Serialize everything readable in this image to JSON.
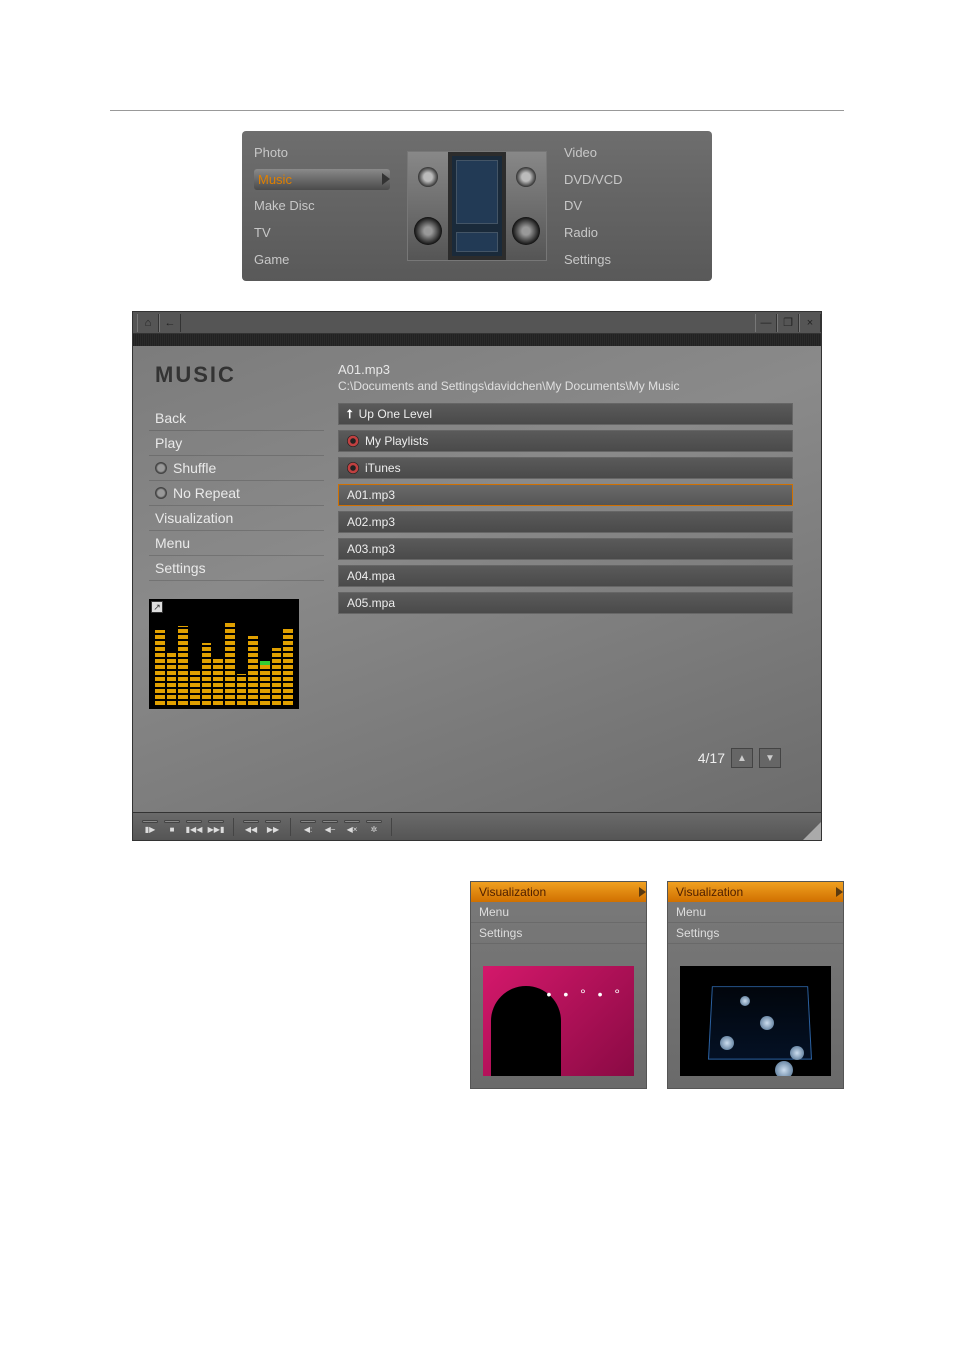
{
  "main_menu": {
    "left": [
      "Photo",
      "Music",
      "Make Disc",
      "TV",
      "Game"
    ],
    "right": [
      "Video",
      "DVD/VCD",
      "DV",
      "Radio",
      "Settings"
    ],
    "active": "Music"
  },
  "music_window": {
    "title": "Music",
    "now_playing": "A01.mp3",
    "path": "C:\\Documents and Settings\\davidchen\\My Documents\\My Music",
    "side_menu": {
      "back": "Back",
      "play": "Play",
      "shuffle": "Shuffle",
      "norepeat": "No Repeat",
      "visualization": "Visualization",
      "menu": "Menu",
      "settings": "Settings"
    },
    "titlebar_icons": {
      "home": "⌂",
      "back": "←",
      "minimize": "—",
      "restore": "❐",
      "close": "×"
    },
    "file_list": [
      {
        "label": "Up One Level",
        "type": "up"
      },
      {
        "label": "My Playlists",
        "type": "disc"
      },
      {
        "label": "iTunes",
        "type": "disc"
      },
      {
        "label": "A01.mp3",
        "type": "file",
        "highlight": true
      },
      {
        "label": "A02.mp3",
        "type": "file"
      },
      {
        "label": "A03.mp3",
        "type": "file"
      },
      {
        "label": "A04.mpa",
        "type": "file"
      },
      {
        "label": "A05.mpa",
        "type": "file"
      }
    ],
    "pager": "4/17",
    "transport_glyphs": {
      "playpause": "▮▶",
      "stop": "■",
      "prev": "▮◀◀",
      "next": "▶▶▮",
      "rew": "◀◀",
      "ffwd": "▶▶",
      "volup": "◀:",
      "voldn": "◀−",
      "volmute": "◀×",
      "cfg": "✲"
    }
  },
  "viz_panels": {
    "sel": "Visualization",
    "menu": "Menu",
    "settings": "Settings"
  }
}
